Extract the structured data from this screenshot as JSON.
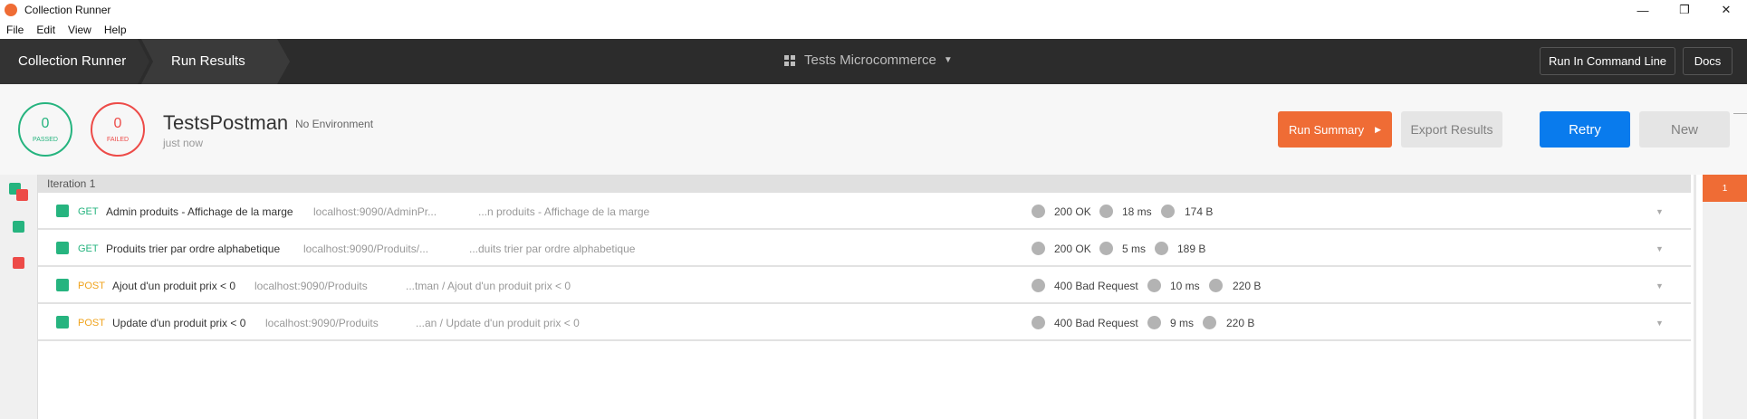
{
  "window": {
    "title": "Collection Runner",
    "controls": {
      "minimize": "—",
      "restore": "❐",
      "close": "✕"
    }
  },
  "menu": [
    "File",
    "Edit",
    "View",
    "Help"
  ],
  "nav": {
    "crumbs": [
      "Collection Runner",
      "Run Results"
    ],
    "collection": "Tests Microcommerce",
    "buttons": {
      "cli": "Run In Command Line",
      "docs": "Docs"
    }
  },
  "summary": {
    "passed_count": "0",
    "passed_label": "PASSED",
    "failed_count": "0",
    "failed_label": "FAILED",
    "run_name": "TestsPostman",
    "environment": "No Environment",
    "time": "just now",
    "buttons": {
      "run_summary": "Run Summary",
      "export": "Export Results",
      "retry": "Retry",
      "new": "New"
    }
  },
  "iteration_label": "Iteration 1",
  "iteration_tab": "1",
  "colors": {
    "pass": "#26b47f",
    "fail": "#ed4b48",
    "accent": "#ef6c35",
    "primary": "#097bed",
    "get": "#26b47f",
    "post": "#f0a31c"
  },
  "requests": [
    {
      "method": "GET",
      "name": "Admin produits - Affichage de la marge",
      "url": "localhost:9090/AdminPr...",
      "path": "...n produits - Affichage de la marge",
      "status": "200 OK",
      "time": "18 ms",
      "size": "174 B"
    },
    {
      "method": "GET",
      "name": "Produits trier par ordre alphabetique",
      "url": "localhost:9090/Produits/...",
      "path": "...duits trier par ordre alphabetique",
      "status": "200 OK",
      "time": "5 ms",
      "size": "189 B"
    },
    {
      "method": "POST",
      "name": "Ajout d'un produit prix < 0",
      "url": "localhost:9090/Produits",
      "path": "...tman / Ajout d'un produit prix < 0",
      "status": "400 Bad Request",
      "time": "10 ms",
      "size": "220 B"
    },
    {
      "method": "POST",
      "name": "Update d'un produit prix < 0",
      "url": "localhost:9090/Produits",
      "path": "...an / Update d'un produit prix < 0",
      "status": "400 Bad Request",
      "time": "9 ms",
      "size": "220 B"
    }
  ]
}
